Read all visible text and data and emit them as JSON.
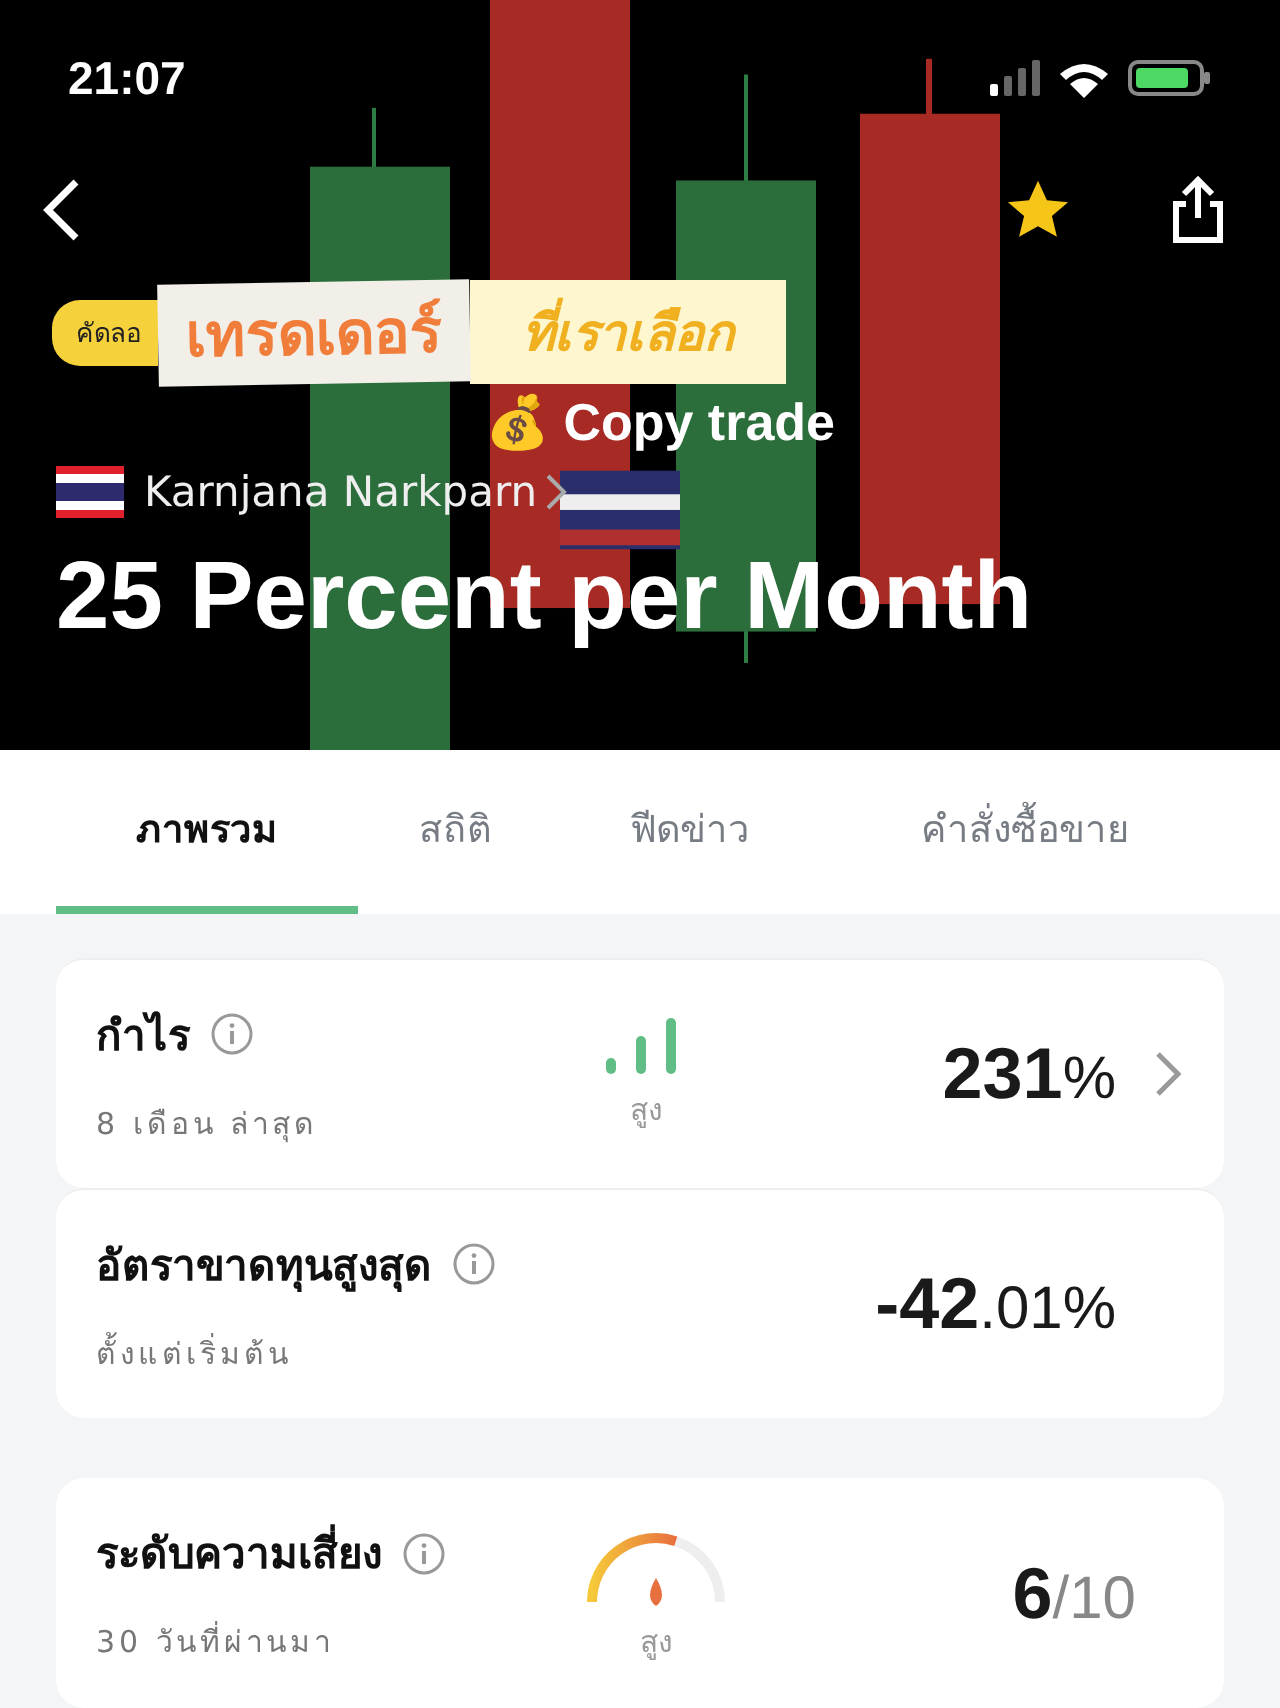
{
  "status_bar": {
    "time": "21:07"
  },
  "header": {
    "badge": "คัดลอ",
    "sticker_main": "เทรดเดอร์",
    "sticker_side": "ที่เราเลือก",
    "caption": "💰 Copy trade",
    "trader_name": "Karnjana Narkparn",
    "title": "25 Percent per Month",
    "favorite": true
  },
  "tabs": [
    {
      "label": "ภาพรวม",
      "selected": true
    },
    {
      "label": "สถิติ",
      "selected": false
    },
    {
      "label": "ฟีดข่าว",
      "selected": false
    },
    {
      "label": "คำสั่งซื้อขาย",
      "selected": false
    }
  ],
  "metrics": [
    {
      "kind": "bars",
      "title": "กำไร",
      "subtitle": "8 เดือน ล่าสุด",
      "indicator_label": "สูง",
      "value_main": "231",
      "value_suffix": "%",
      "chevron": true
    },
    {
      "kind": "plain",
      "title": "อัตราขาดทุนสูงสุด",
      "subtitle": "ตั้งแต่เริ่มต้น",
      "value_main": "-42",
      "value_suffix": ".01%",
      "chevron": false
    },
    {
      "kind": "gauge",
      "title": "ระดับความเสี่ยง",
      "subtitle": "30 วันที่ผ่านมา",
      "indicator_label": "สูง",
      "value_main": "6",
      "value_suffix": "/10",
      "chevron": false
    }
  ]
}
